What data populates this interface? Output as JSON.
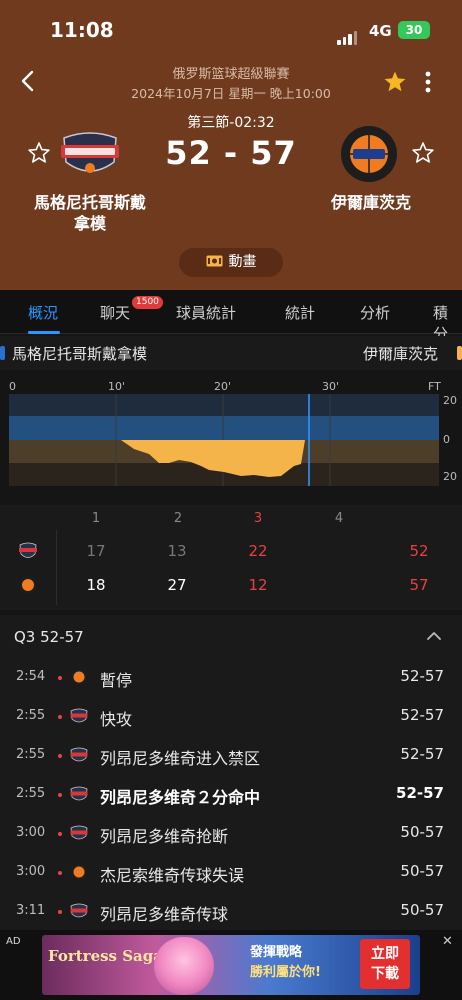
{
  "status": {
    "time": "11:08",
    "network": "4G",
    "battery": "30"
  },
  "match": {
    "league": "俄罗斯篮球超級聯賽",
    "datetime": "2024年10月7日 星期一 晚上10:00",
    "period": "第三節-02:32",
    "score": "52 - 57",
    "home": {
      "name_line1": "馬格尼托哥斯戴",
      "name_line2": "拿模",
      "logo": "basketball-shield-logo"
    },
    "away": {
      "name_line1": "伊爾庫茨克",
      "logo": "orange-basketball-logo"
    }
  },
  "anim_button": {
    "label": "動畫",
    "icon": "animation-icon"
  },
  "tabs": [
    {
      "label": "概況"
    },
    {
      "label": "聊天",
      "badge": "1500"
    },
    {
      "label": "球員統計"
    },
    {
      "label": "統計"
    },
    {
      "label": "分析"
    },
    {
      "label": "積分"
    }
  ],
  "timeline": {
    "home": "馬格尼托哥斯戴拿模",
    "away": "伊爾庫茨克",
    "x_ticks": [
      "0",
      "10'",
      "20'",
      "30'",
      "FT"
    ],
    "y_ticks": [
      "20",
      "0",
      "20"
    ],
    "colors": {
      "home": "#2a6fd6",
      "away": "#f5b44a"
    }
  },
  "quarters": {
    "headers": [
      "1",
      "2",
      "3",
      "4"
    ],
    "home": [
      "17",
      "13",
      "22",
      "",
      "52"
    ],
    "away": [
      "18",
      "27",
      "12",
      "",
      "57"
    ],
    "highlight_color": "#e84040"
  },
  "events": {
    "quarter_label": "Q3  52-57",
    "items": [
      {
        "time": "2:54",
        "team": "away",
        "desc": "暫停",
        "score": "52-57",
        "bold": false
      },
      {
        "time": "2:55",
        "team": "home",
        "desc": "快攻",
        "score": "52-57",
        "bold": false
      },
      {
        "time": "2:55",
        "team": "home",
        "desc": "列昂尼多维奇进入禁区",
        "score": "52-57",
        "bold": false
      },
      {
        "time": "2:55",
        "team": "home",
        "desc": "列昂尼多维奇２分命中",
        "score": "52-57",
        "bold": true
      },
      {
        "time": "3:00",
        "team": "home",
        "desc": "列昂尼多维奇抢断",
        "score": "50-57",
        "bold": false
      },
      {
        "time": "3:00",
        "team": "away",
        "desc": "杰尼索维奇传球失误",
        "score": "50-57",
        "bold": false
      },
      {
        "time": "3:11",
        "team": "home",
        "desc": "列昂尼多维奇传球",
        "score": "50-57",
        "bold": false
      }
    ]
  },
  "ad": {
    "label": "AD",
    "close": "✕",
    "game": "Fortress Saga",
    "slogan1": "發揮戰略",
    "slogan2": "勝利屬於你!",
    "cta": "立即下載"
  }
}
